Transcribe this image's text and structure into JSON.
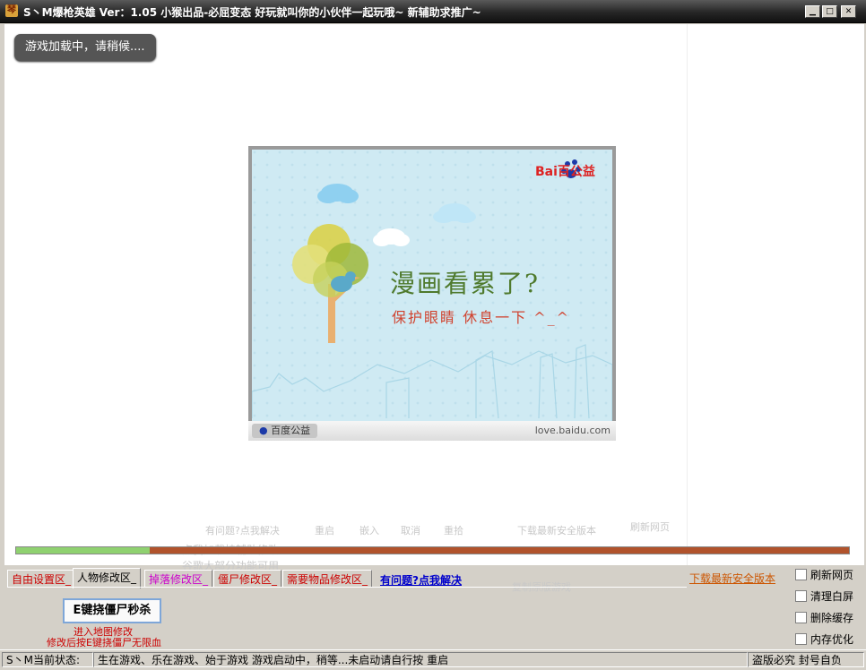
{
  "window": {
    "title": "S丶M爆枪英雄 Ver：1.05 小猴出品-必屈变态 好玩就叫你的小伙伴一起玩哦~   新辅助求推广~",
    "app_icon": "琴",
    "buttons": {
      "minimize": "▁",
      "maximize": "□",
      "close": "✕"
    }
  },
  "loading_toast": "游戏加载中，请稍候....",
  "ad": {
    "logo": "Bai百公益",
    "headline": "漫画看累了?",
    "subline": "保护眼睛 休息一下 ^_^",
    "footer_brand": "百度公益",
    "footer_url": "love.baidu.com"
  },
  "ghost_overlay": {
    "help_link": "有问题?点我解决",
    "btn1": "重启",
    "btn2": "嵌入",
    "btn3": "取消",
    "btn4": "重拾",
    "dl": "下载最新安全版本",
    "chk": "刷新网页",
    "line1": "点我加载挂辅助修改",
    "line2": "谷歌大部分功能可用",
    "line3": "复制原版游戏"
  },
  "progress": {
    "percent": 16
  },
  "tabs": [
    {
      "label": "自由设置区_",
      "color": "#cc0000"
    },
    {
      "label": "人物修改区_",
      "color": "#000000",
      "active": true
    },
    {
      "label": "掉落修改区_",
      "color": "#cc00cc"
    },
    {
      "label": "僵尸修改区_",
      "color": "#cc0000"
    },
    {
      "label": "需要物品修改区_",
      "color": "#cc0000"
    }
  ],
  "help_link": "有问题?点我解决",
  "download_link": "下载最新安全版本",
  "kill_button": "E键挠僵尸秒杀",
  "kill_hint1": "进入地图修改",
  "kill_hint2": "修改后按E键挠僵尸无限血",
  "checkboxes": [
    "刷新网页",
    "清理白屏",
    "删除缓存",
    "内存优化"
  ],
  "status": {
    "label": "S丶M当前状态:",
    "message": "生在游戏、乐在游戏、始于游戏  游戏启动中，稍等...未启动请自行按 重启",
    "right": "盗版必究 封号自负"
  }
}
